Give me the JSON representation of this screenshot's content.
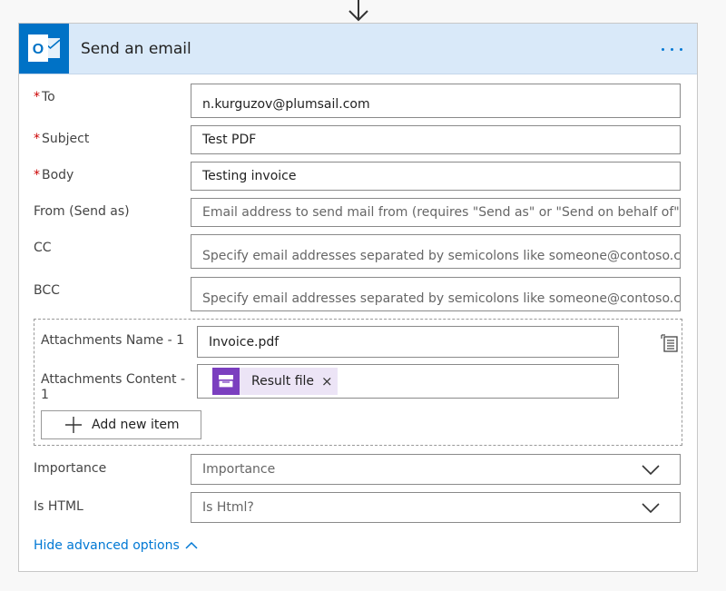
{
  "card": {
    "title": "Send an email",
    "app_icon_letter": "O"
  },
  "fields": {
    "to": {
      "label": "To",
      "value": "n.kurguzov@plumsail.com",
      "required_mark": "*"
    },
    "subject": {
      "label": "Subject",
      "value": "Test PDF",
      "required_mark": "*"
    },
    "body": {
      "label": "Body",
      "value": "Testing invoice",
      "required_mark": "*"
    },
    "from": {
      "label": "From (Send as)",
      "placeholder": "Email address to send mail from (requires \"Send as\" or \"Send on behalf of\""
    },
    "cc": {
      "label": "CC",
      "placeholder": "Specify email addresses separated by semicolons like someone@contoso.com"
    },
    "bcc": {
      "label": "BCC",
      "placeholder": "Specify email addresses separated by semicolons like someone@contoso.com"
    }
  },
  "attachments": {
    "name_label": "Attachments Name - 1",
    "name_value": "Invoice.pdf",
    "content_label_line1": "Attachments Content -",
    "content_label_line2": "1",
    "token_label": "Result file",
    "token_remove": "×",
    "add_button_label": "Add new item"
  },
  "importance": {
    "label": "Importance",
    "value": "Importance"
  },
  "is_html": {
    "label": "Is HTML",
    "value": "Is Html?"
  },
  "advanced_link": "Hide advanced options",
  "colors": {
    "accent": "#0078d4",
    "header_bg": "#d9e9f9",
    "outlook_blue": "#0072c6",
    "token_purple": "#7b3fbf",
    "required_red": "#cc0000"
  }
}
